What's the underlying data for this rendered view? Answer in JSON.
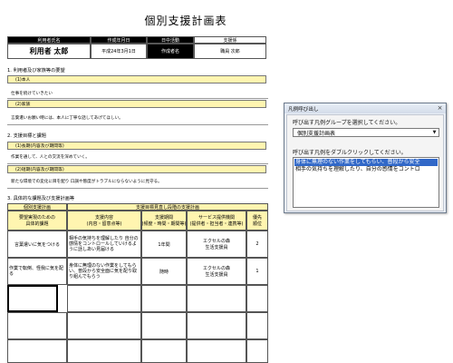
{
  "document": {
    "title": "個別支援計画表",
    "header": {
      "user_label": "利用者氏名",
      "date_label": "作成年月日",
      "activity_label": "日中活動",
      "user_name": "利用者 太郎",
      "date_value": "平成24年3月1日",
      "activity_value": "支援係",
      "author_label": "作成者名",
      "author_value": "職員 次郎"
    },
    "section1": {
      "heading": "1. 利用者及び家族等の要望",
      "self_label": "(1)本人",
      "self_text": "仕事を続けていきたい",
      "family_label": "(2)家族",
      "family_text": "言葉遣いお願い時には、本人に丁寧な話してあげてほしい。"
    },
    "section2": {
      "heading": "2. 支援目標と課題",
      "long_label": "(1)長期(内容及び期間等)",
      "long_text": "作業を通して、人との交流を深めていく。",
      "short_label": "(2)短期(内容及び期間等)",
      "short_text": "新たな環境での変化に目を配り 口調や態度がトラブルにならないように見守る。"
    },
    "section3": {
      "heading": "3. 具体的な課題及び支援計画等",
      "col_group1": "個別支援計画",
      "col_group2": "支援目標見直し段階の支援計画",
      "columns": [
        "要望実現のための\n具体的課題",
        "支援内容\n(内容・留意点等)",
        "支援期間\n(頻度・時間・期間等)",
        "サービス提供機関\n(提供者・担当者・連携等)",
        "優先\n順位"
      ],
      "rows": [
        {
          "task": "言葉遣いに気をつける",
          "content": "相手の気持ちを理解したり 自分の感情をコントロールしていけるように話しあい見届ける",
          "period": "1年間",
          "provider": "エクセルの森\n生活支援員",
          "priority": "2"
        },
        {
          "task": "作業で転倒、怪我に気を配る",
          "content": "身体に無理のない作業をしてもらい、普段から安全面に気を配り取り組んでもらう",
          "period": "随時",
          "provider": "エクセルの森\n生活支援員",
          "priority": "1"
        }
      ]
    }
  },
  "dialog": {
    "title": "凡例呼び出し",
    "close_glyph": "×",
    "prompt_group": "呼び出す凡例グループを選択してください。",
    "combo_value": "個別支援計画表",
    "prompt_item": "呼び出す凡例をダブルクリックしてください。",
    "items": [
      "身体に無理のない作業をしてもらい、普段から安全",
      "相手の気持ちを理解したり、自分の感情をコントロ"
    ],
    "selected_index": 0
  }
}
